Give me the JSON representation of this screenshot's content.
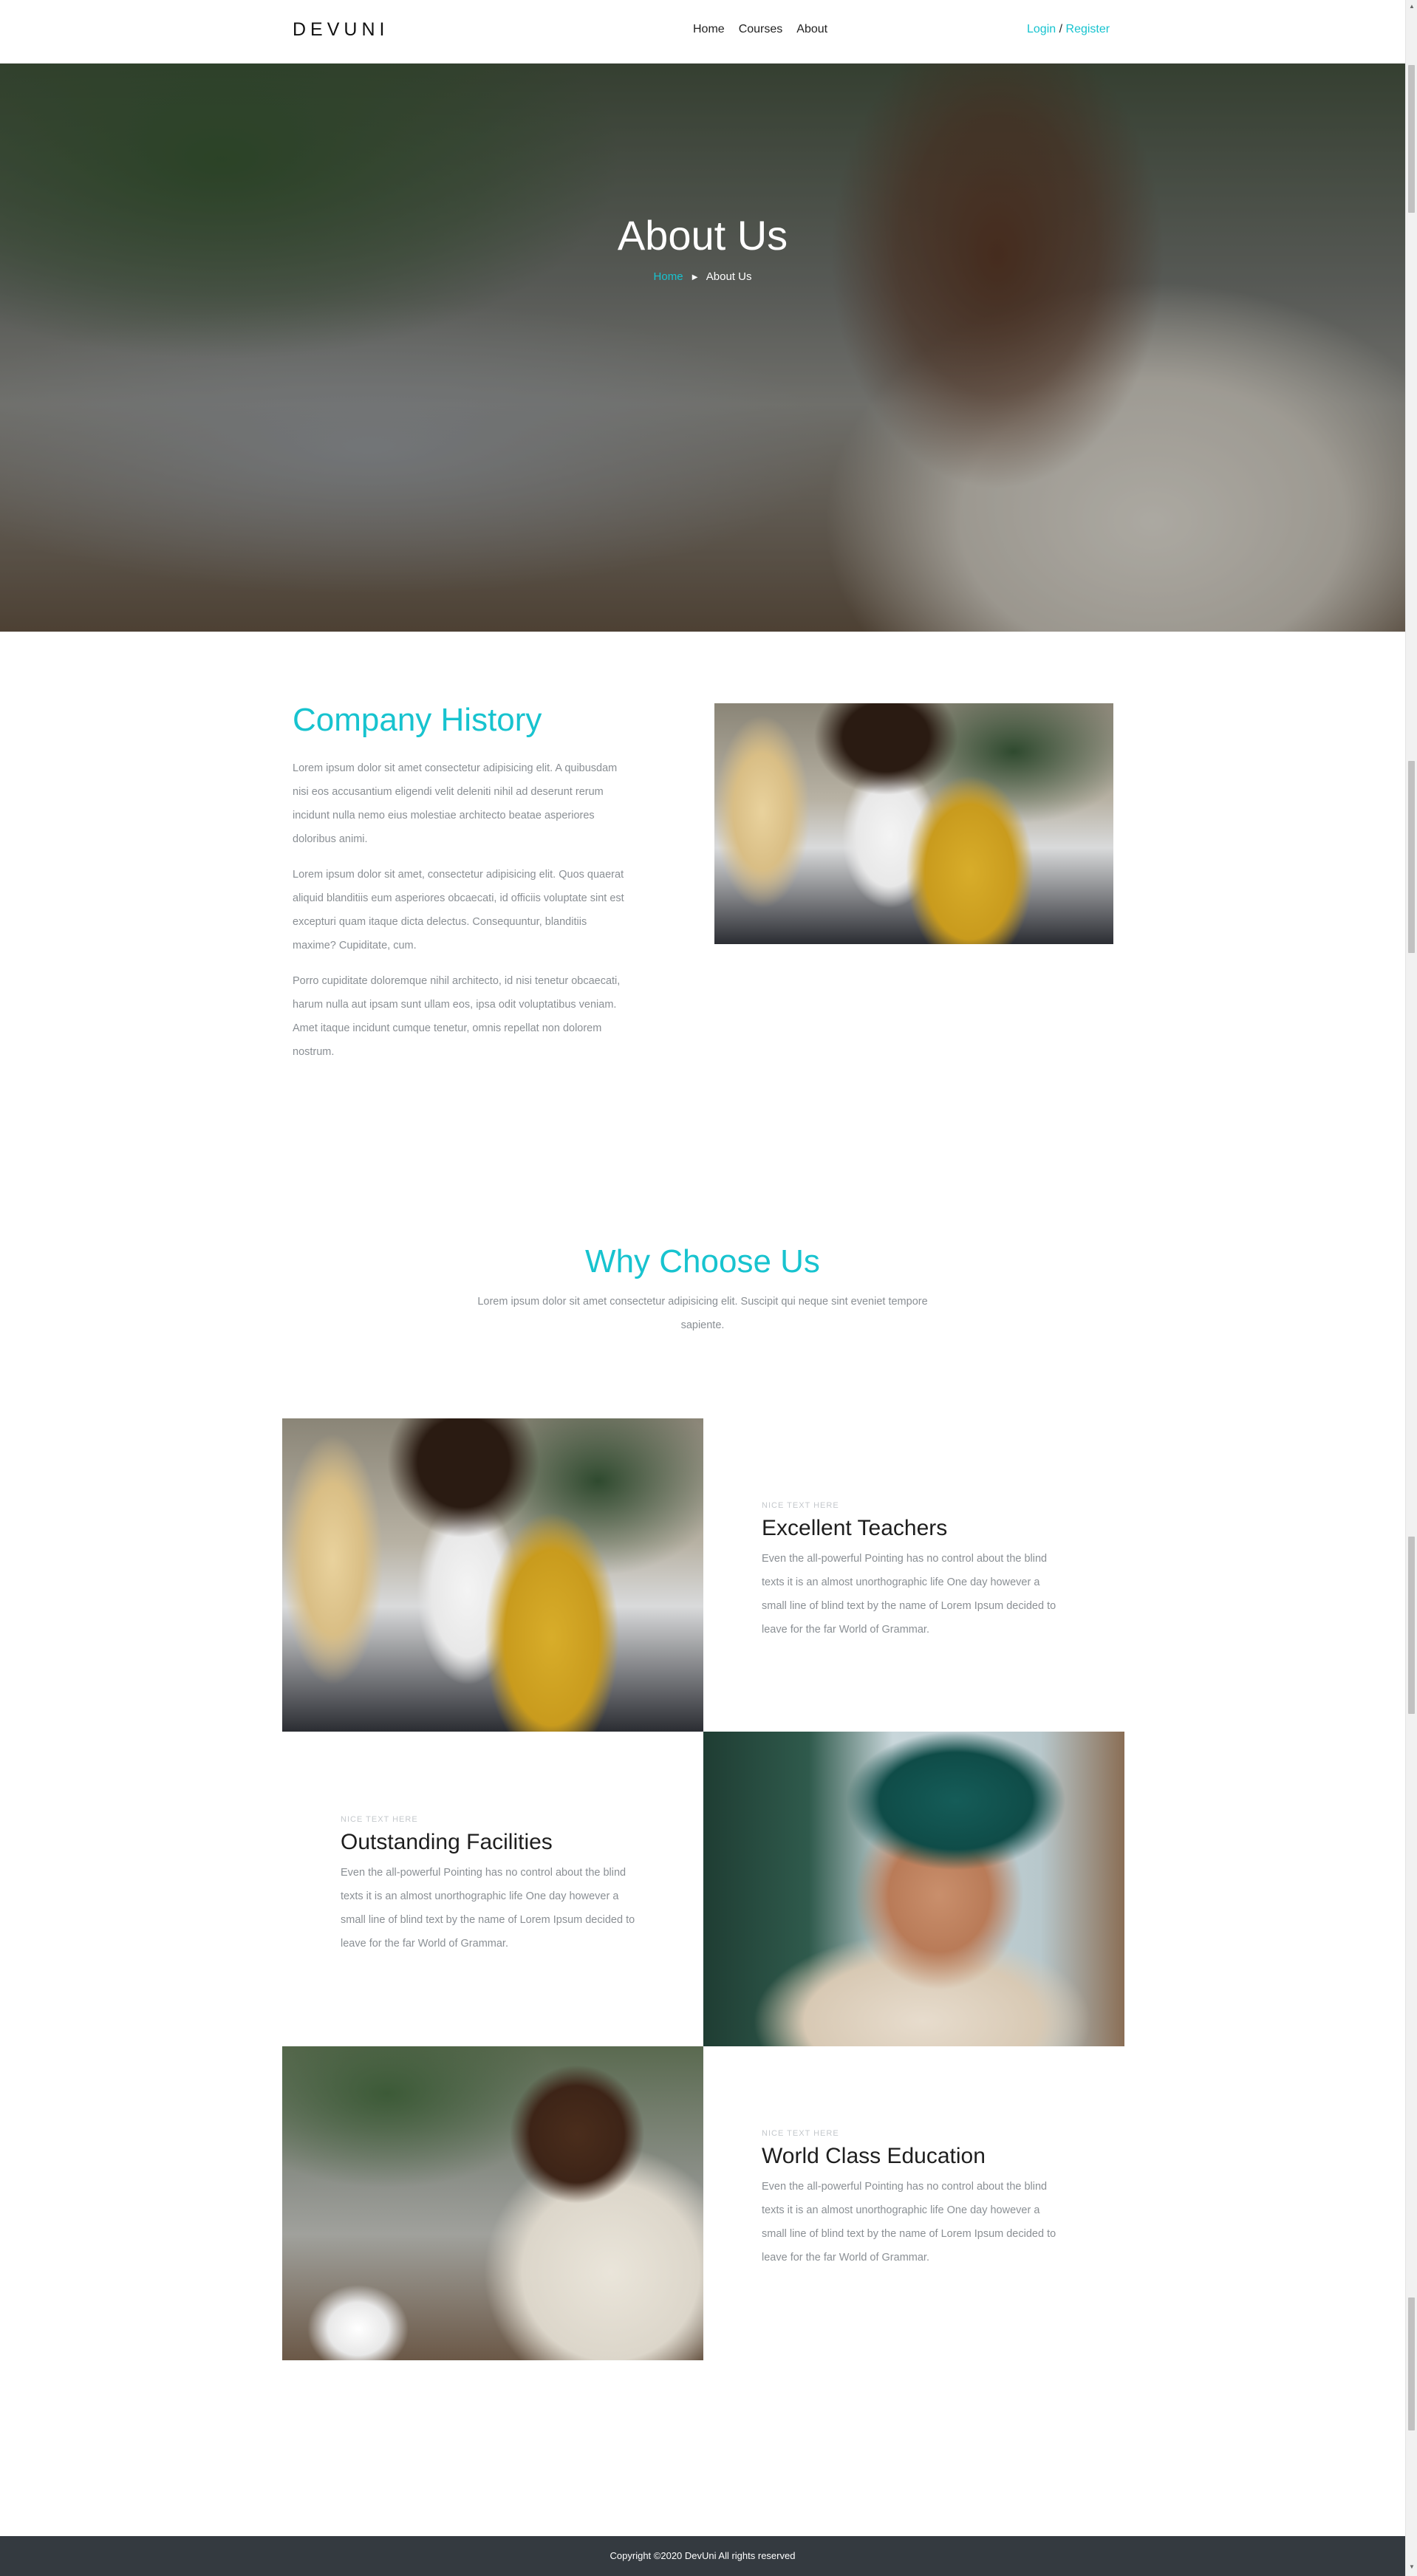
{
  "nav": {
    "brand": "DEVUNI",
    "links": [
      "Home",
      "Courses",
      "About"
    ],
    "login": "Login",
    "separator": "/",
    "register": "Register"
  },
  "hero": {
    "title": "About Us",
    "breadcrumb_home": "Home",
    "breadcrumb_current": "About Us"
  },
  "history": {
    "title": "Company History",
    "paragraphs": [
      "Lorem ipsum dolor sit amet consectetur adipisicing elit. A quibusdam nisi eos accusantium eligendi velit deleniti nihil ad deserunt rerum incidunt nulla nemo eius molestiae architecto beatae asperiores doloribus animi.",
      "Lorem ipsum dolor sit amet, consectetur adipisicing elit. Quos quaerat aliquid blanditiis eum asperiores obcaecati, id officiis voluptate sint est excepturi quam itaque dicta delectus. Consequuntur, blanditiis maxime? Cupiditate, cum.",
      "Porro cupiditate doloremque nihil architecto, id nisi tenetur obcaecati, harum nulla aut ipsam sunt ullam eos, ipsa odit voluptatibus veniam. Amet itaque incidunt cumque tenetur, omnis repellat non dolorem nostrum."
    ]
  },
  "why": {
    "title": "Why Choose Us",
    "subtitle": "Lorem ipsum dolor sit amet consectetur adipisicing elit. Suscipit qui neque sint eveniet tempore sapiente.",
    "features": [
      {
        "kicker": "NICE TEXT HERE",
        "title": "Excellent Teachers",
        "text": "Even the all-powerful Pointing has no control about the blind texts it is an almost unorthographic life One day however a small line of blind text by the name of Lorem Ipsum decided to leave for the far World of Grammar."
      },
      {
        "kicker": "NICE TEXT HERE",
        "title": "Outstanding Facilities",
        "text": "Even the all-powerful Pointing has no control about the blind texts it is an almost unorthographic life One day however a small line of blind text by the name of Lorem Ipsum decided to leave for the far World of Grammar."
      },
      {
        "kicker": "NICE TEXT HERE",
        "title": "World Class Education",
        "text": "Even the all-powerful Pointing has no control about the blind texts it is an almost unorthographic life One day however a small line of blind text by the name of Lorem Ipsum decided to leave for the far World of Grammar."
      }
    ]
  },
  "footer": {
    "copyright": "Copyright ©2020 DevUni All rights reserved"
  },
  "colors": {
    "accent": "#17c3cf",
    "footer_bg": "#343a40",
    "heading": "#1e1e1e",
    "body_text": "#8a8f94"
  }
}
